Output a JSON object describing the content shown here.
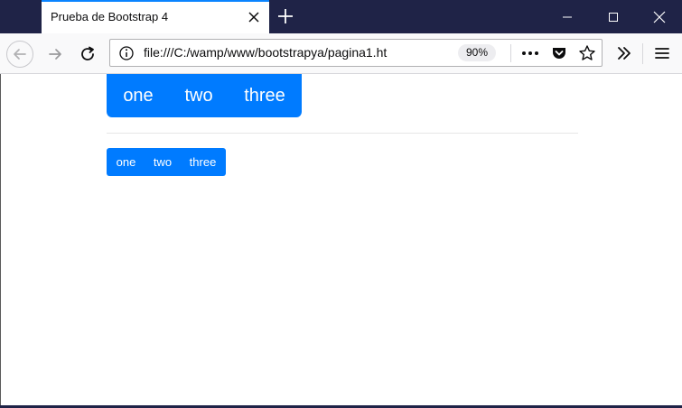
{
  "window": {
    "tab_title": "Prueba de Bootstrap 4"
  },
  "navbar": {
    "url": "file:///C:/wamp/www/bootstrapya/pagina1.ht",
    "zoom": "90%"
  },
  "content": {
    "large_group": [
      "one",
      "two",
      "three"
    ],
    "small_group": [
      "one",
      "two",
      "three"
    ]
  },
  "colors": {
    "primary": "#007bff",
    "titlebar": "#1f2347",
    "tab_accent": "#0a84ff"
  },
  "icons": [
    "close-icon",
    "plus-icon",
    "minimize-icon",
    "maximize-icon",
    "window-close-icon",
    "back-arrow-icon",
    "forward-arrow-icon",
    "reload-icon",
    "info-icon",
    "more-dots-icon",
    "pocket-icon",
    "star-icon",
    "overflow-chevrons-icon",
    "hamburger-menu-icon"
  ]
}
